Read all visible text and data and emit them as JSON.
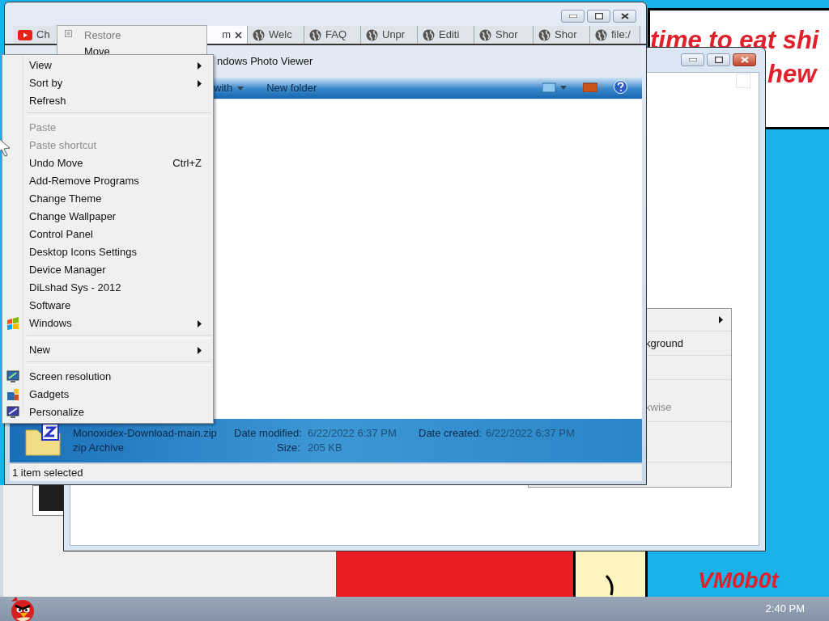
{
  "wallpaper": {
    "bubble_lines": [
      "time to eat shi",
      "hew"
    ],
    "signature": "VM0b0t"
  },
  "hidden_menu": {
    "items": [
      {
        "kind": "item",
        "submenu": true
      },
      {
        "kind": "item",
        "label": "kground",
        "disabled": false
      },
      {
        "kind": "blank"
      },
      {
        "kind": "item",
        "label": "kwise",
        "disabled": true
      },
      {
        "kind": "blank"
      }
    ]
  },
  "browser": {
    "tabs": [
      {
        "kind": "video",
        "label": "Ch",
        "selected": false,
        "closable": false
      },
      {
        "kind": "plain",
        "label": "m",
        "selected": true,
        "closable": true
      },
      {
        "kind": "site",
        "label": "Welc",
        "selected": false,
        "closable": false
      },
      {
        "kind": "site",
        "label": "FAQ",
        "selected": false,
        "closable": false
      },
      {
        "kind": "site",
        "label": "Unpr",
        "selected": false,
        "closable": false
      },
      {
        "kind": "site",
        "label": "Editi",
        "selected": false,
        "closable": false
      },
      {
        "kind": "site",
        "label": "Shor",
        "selected": false,
        "closable": false
      },
      {
        "kind": "site",
        "label": "Shor",
        "selected": false,
        "closable": false
      },
      {
        "kind": "site",
        "label": "file:/",
        "selected": false,
        "closable": false
      }
    ]
  },
  "explorer": {
    "title": "ndows Photo Viewer",
    "toolbar": [
      {
        "label": "with",
        "dropdown": true
      },
      {
        "label": "New folder",
        "dropdown": false
      }
    ],
    "details": {
      "name": "Monoxidex-Download-main.zip",
      "type": "zip Archive",
      "fields": [
        {
          "label": "Date modified:",
          "value": "6/22/2022 6:37 PM"
        },
        {
          "label": "Size:",
          "value": "205 KB"
        },
        {
          "label": "Date created:",
          "value": "6/22/2022 6:37 PM"
        }
      ]
    },
    "status": "1 item selected"
  },
  "system_menu": {
    "items": [
      {
        "label": "Restore",
        "disabled": true
      },
      {
        "label": "Move",
        "disabled": false
      }
    ]
  },
  "context_menu": {
    "items": [
      {
        "kind": "item",
        "label": "View",
        "submenu": true,
        "disabled": false
      },
      {
        "kind": "item",
        "label": "Sort by",
        "submenu": true,
        "disabled": false
      },
      {
        "kind": "item",
        "label": "Refresh",
        "submenu": false,
        "disabled": false
      },
      {
        "kind": "separator"
      },
      {
        "kind": "item",
        "label": "Paste",
        "submenu": false,
        "disabled": true
      },
      {
        "kind": "item",
        "label": "Paste shortcut",
        "submenu": false,
        "disabled": true
      },
      {
        "kind": "item",
        "label": "Undo Move",
        "shortcut": "Ctrl+Z",
        "submenu": false,
        "disabled": false
      },
      {
        "kind": "item",
        "label": "Add-Remove Programs",
        "submenu": false,
        "disabled": false
      },
      {
        "kind": "item",
        "label": "Change Theme",
        "submenu": false,
        "disabled": false
      },
      {
        "kind": "item",
        "label": "Change Wallpaper",
        "submenu": false,
        "disabled": false
      },
      {
        "kind": "item",
        "label": "Control Panel",
        "submenu": false,
        "disabled": false
      },
      {
        "kind": "item",
        "label": "Desktop Icons Settings",
        "submenu": false,
        "disabled": false
      },
      {
        "kind": "item",
        "label": "Device Manager",
        "submenu": false,
        "disabled": false
      },
      {
        "kind": "item",
        "label": "DiLshad Sys - 2012",
        "submenu": false,
        "disabled": false
      },
      {
        "kind": "item",
        "label": "Software",
        "submenu": false,
        "disabled": false
      },
      {
        "kind": "item",
        "label": "Windows",
        "submenu": true,
        "disabled": false
      },
      {
        "kind": "separator"
      },
      {
        "kind": "item",
        "label": "New",
        "submenu": true,
        "disabled": false
      },
      {
        "kind": "separator"
      },
      {
        "kind": "item",
        "label": "Screen resolution",
        "submenu": false,
        "disabled": false
      },
      {
        "kind": "item",
        "label": "Gadgets",
        "submenu": false,
        "disabled": false
      },
      {
        "kind": "item",
        "label": "Personalize",
        "submenu": false,
        "disabled": false
      }
    ]
  },
  "taskbar": {
    "clock": "2:40 PM"
  }
}
